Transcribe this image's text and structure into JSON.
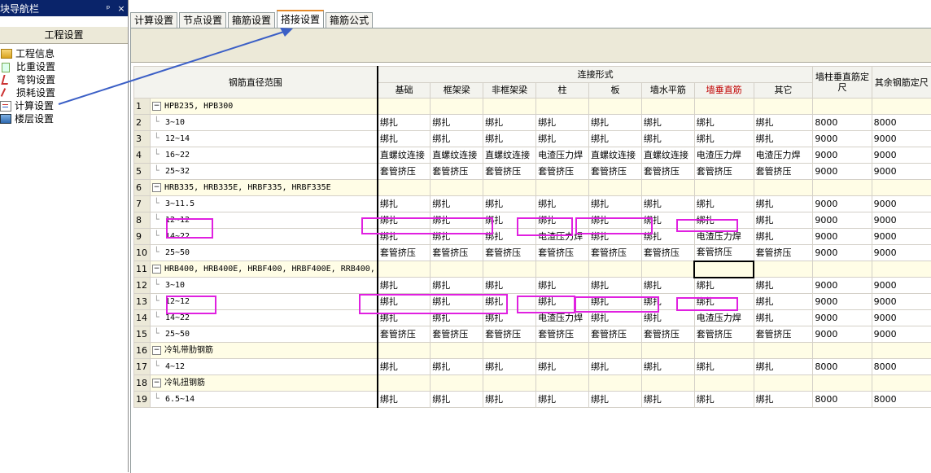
{
  "nav": {
    "title": "块导航栏",
    "pin": "ᵖ",
    "close": "×",
    "section": "工程设置",
    "items": [
      {
        "label": "工程信息",
        "icon": "info-icon"
      },
      {
        "label": "比重设置",
        "icon": "weight-icon"
      },
      {
        "label": "弯钩设置",
        "icon": "hook-icon"
      },
      {
        "label": "损耗设置",
        "icon": "loss-icon"
      },
      {
        "label": "计算设置",
        "icon": "calc-icon"
      },
      {
        "label": "楼层设置",
        "icon": "floor-icon"
      }
    ]
  },
  "tabs": [
    "计算设置",
    "节点设置",
    "箍筋设置",
    "搭接设置",
    "箍筋公式"
  ],
  "active_tab": "搭接设置",
  "grid": {
    "headers": {
      "range": "钢筋直径范围",
      "join": "连接形式",
      "cols": [
        "基础",
        "框架梁",
        "非框架梁",
        "柱",
        "板",
        "墙水平筋",
        "墙垂直筋",
        "其它"
      ],
      "wall_fix": "墙柱垂直筋定尺",
      "other_fix": "其余钢筋定尺"
    },
    "rows": [
      {
        "n": "1",
        "group": true,
        "label": "HPB235, HPB300"
      },
      {
        "n": "2",
        "label": "3~10",
        "vals": [
          "绑扎",
          "绑扎",
          "绑扎",
          "绑扎",
          "绑扎",
          "绑扎",
          "绑扎",
          "绑扎"
        ],
        "a": "8000",
        "b": "8000"
      },
      {
        "n": "3",
        "label": "12~14",
        "vals": [
          "绑扎",
          "绑扎",
          "绑扎",
          "绑扎",
          "绑扎",
          "绑扎",
          "绑扎",
          "绑扎"
        ],
        "a": "9000",
        "b": "9000"
      },
      {
        "n": "4",
        "label": "16~22",
        "vals": [
          "直螺纹连接",
          "直螺纹连接",
          "直螺纹连接",
          "电渣压力焊",
          "直螺纹连接",
          "直螺纹连接",
          "电渣压力焊",
          "电渣压力焊"
        ],
        "a": "9000",
        "b": "9000"
      },
      {
        "n": "5",
        "label": "25~32",
        "vals": [
          "套管挤压",
          "套管挤压",
          "套管挤压",
          "套管挤压",
          "套管挤压",
          "套管挤压",
          "套管挤压",
          "套管挤压"
        ],
        "a": "9000",
        "b": "9000"
      },
      {
        "n": "6",
        "group": true,
        "label": "HRB335, HRB335E, HRBF335, HRBF335E"
      },
      {
        "n": "7",
        "label": "3~11.5",
        "vals": [
          "绑扎",
          "绑扎",
          "绑扎",
          "绑扎",
          "绑扎",
          "绑扎",
          "绑扎",
          "绑扎"
        ],
        "a": "9000",
        "b": "9000"
      },
      {
        "n": "8",
        "label": "12~12",
        "vals": [
          "绑扎",
          "绑扎",
          "绑扎",
          "绑扎",
          "绑扎",
          "绑扎",
          "绑扎",
          "绑扎"
        ],
        "a": "9000",
        "b": "9000"
      },
      {
        "n": "9",
        "label": "14~22",
        "vals": [
          "绑扎",
          "绑扎",
          "绑扎",
          "电渣压力焊",
          "绑扎",
          "绑扎",
          "电渣压力焊",
          "绑扎"
        ],
        "a": "9000",
        "b": "9000"
      },
      {
        "n": "10",
        "label": "25~50",
        "vals": [
          "套管挤压",
          "套管挤压",
          "套管挤压",
          "套管挤压",
          "套管挤压",
          "套管挤压",
          "套管挤压",
          "套管挤压"
        ],
        "a": "9000",
        "b": "9000"
      },
      {
        "n": "11",
        "group": true,
        "selected": true,
        "label": "HRB400, HRB400E, HRBF400, HRBF400E, RRB400,"
      },
      {
        "n": "12",
        "label": "3~10",
        "vals": [
          "绑扎",
          "绑扎",
          "绑扎",
          "绑扎",
          "绑扎",
          "绑扎",
          "绑扎",
          "绑扎"
        ],
        "a": "9000",
        "b": "9000"
      },
      {
        "n": "13",
        "label": "12~12",
        "vals": [
          "绑扎",
          "绑扎",
          "绑扎",
          "绑扎",
          "绑扎",
          "绑扎",
          "绑扎",
          "绑扎"
        ],
        "a": "9000",
        "b": "9000"
      },
      {
        "n": "14",
        "label": "14~22",
        "vals": [
          "绑扎",
          "绑扎",
          "绑扎",
          "电渣压力焊",
          "绑扎",
          "绑扎",
          "电渣压力焊",
          "绑扎"
        ],
        "a": "9000",
        "b": "9000"
      },
      {
        "n": "15",
        "label": "25~50",
        "vals": [
          "套管挤压",
          "套管挤压",
          "套管挤压",
          "套管挤压",
          "套管挤压",
          "套管挤压",
          "套管挤压",
          "套管挤压"
        ],
        "a": "9000",
        "b": "9000"
      },
      {
        "n": "16",
        "group": true,
        "label": "冷轧带肋钢筋"
      },
      {
        "n": "17",
        "label": "4~12",
        "vals": [
          "绑扎",
          "绑扎",
          "绑扎",
          "绑扎",
          "绑扎",
          "绑扎",
          "绑扎",
          "绑扎"
        ],
        "a": "8000",
        "b": "8000"
      },
      {
        "n": "18",
        "group": true,
        "label": "冷轧扭钢筋"
      },
      {
        "n": "19",
        "label": "6.5~14",
        "vals": [
          "绑扎",
          "绑扎",
          "绑扎",
          "绑扎",
          "绑扎",
          "绑扎",
          "绑扎",
          "绑扎"
        ],
        "a": "8000",
        "b": "8000"
      }
    ]
  },
  "colors": {
    "highlight": "#e020e0",
    "arrow": "#3b5fc6",
    "header_highlight": "#ffe49a"
  }
}
